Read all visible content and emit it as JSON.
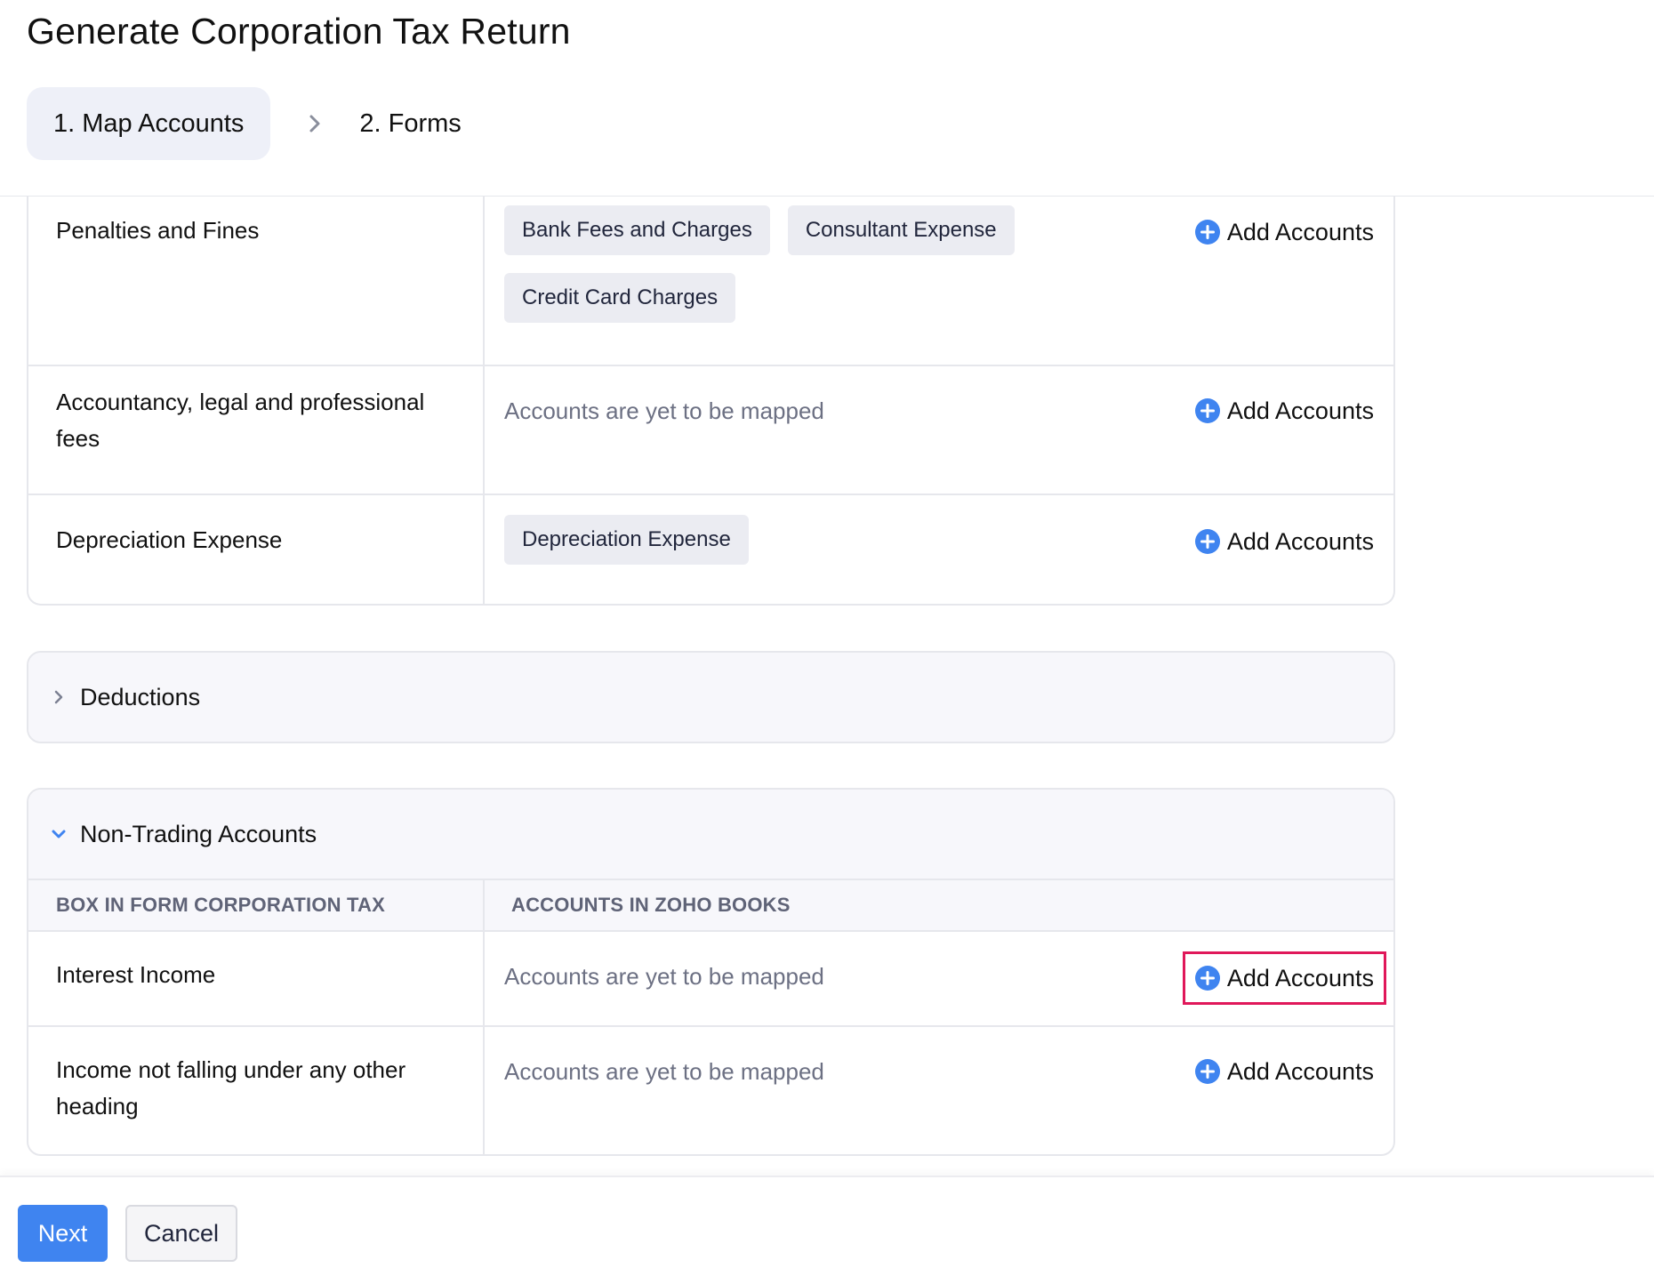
{
  "page": {
    "title": "Generate Corporation Tax Return"
  },
  "stepper": {
    "steps": [
      {
        "label": "1. Map Accounts",
        "active": true
      },
      {
        "label": "2. Forms",
        "active": false
      }
    ]
  },
  "expense_rows": [
    {
      "label": "Penalties and Fines",
      "chips": [
        "Bank Fees and Charges",
        "Consultant Expense",
        "Credit Card Charges"
      ],
      "add_label": "Add Accounts"
    },
    {
      "label": "Accountancy, legal and professional fees",
      "unmapped_text": "Accounts are yet to be mapped",
      "add_label": "Add Accounts"
    },
    {
      "label": "Depreciation Expense",
      "chips": [
        "Depreciation Expense"
      ],
      "add_label": "Add Accounts"
    }
  ],
  "deductions": {
    "title": "Deductions",
    "expanded": false
  },
  "non_trading": {
    "title": "Non-Trading Accounts",
    "expanded": true,
    "columns": [
      "BOX IN FORM CORPORATION TAX",
      "ACCOUNTS IN ZOHO BOOKS"
    ],
    "rows": [
      {
        "label": "Interest Income",
        "unmapped_text": "Accounts are yet to be mapped",
        "add_label": "Add Accounts",
        "highlighted": true
      },
      {
        "label": "Income not falling under any other heading",
        "unmapped_text": "Accounts are yet to be mapped",
        "add_label": "Add Accounts"
      }
    ]
  },
  "footer": {
    "next_label": "Next",
    "cancel_label": "Cancel"
  },
  "colors": {
    "accent": "#3f84f0",
    "highlight": "#e0185a",
    "chip_bg": "#ebecf2"
  }
}
